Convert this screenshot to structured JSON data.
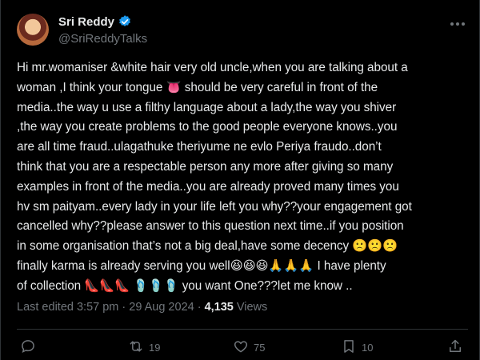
{
  "author": {
    "name": "Sri Reddy",
    "handle": "@SriReddyTalks"
  },
  "tweet": {
    "text": "Hi mr.womaniser &white hair very old uncle,when you are talking about a\nwoman ,I think your tongue 👅 should be very careful  in front of the\nmedia..the way u use a filthy language about a lady,the way you shiver\n,the way you create problems to the good people everyone knows..you\nare all time fraud..ulagathuke theriyume ne evlo Periya fraudo..don’t\nthink that you are a respectable person any more after giving so many\nexamples in front of the media..you are already proved many times you\nhv sm paityam..every lady in your life left you why??your engagement got\ncancelled why??please answer to this question next time..if you position\nin some organisation that’s not a big deal,have some decency 🙁🙁🙁\nfinally karma is already serving you well😆😆😆🙏🙏🙏 I have plenty\nof collection 👠👠👠 🩴🩴🩴 you want One???let me know .."
  },
  "meta": {
    "edited": "Last edited 3:57 pm · 29 Aug 2024 ·",
    "views_count": "4,135",
    "views_label": "Views"
  },
  "actions": {
    "replies": "",
    "reposts": "19",
    "likes": "75",
    "bookmarks": "10"
  },
  "colors": {
    "background": "#000000",
    "text": "#e7e9ea",
    "secondary": "#71767b",
    "verified": "#1d9bf0",
    "divider": "#2f3336"
  },
  "icons": [
    "verified-badge-icon",
    "more-options-icon",
    "reply-icon",
    "repost-icon",
    "like-icon",
    "bookmark-icon",
    "share-icon"
  ]
}
